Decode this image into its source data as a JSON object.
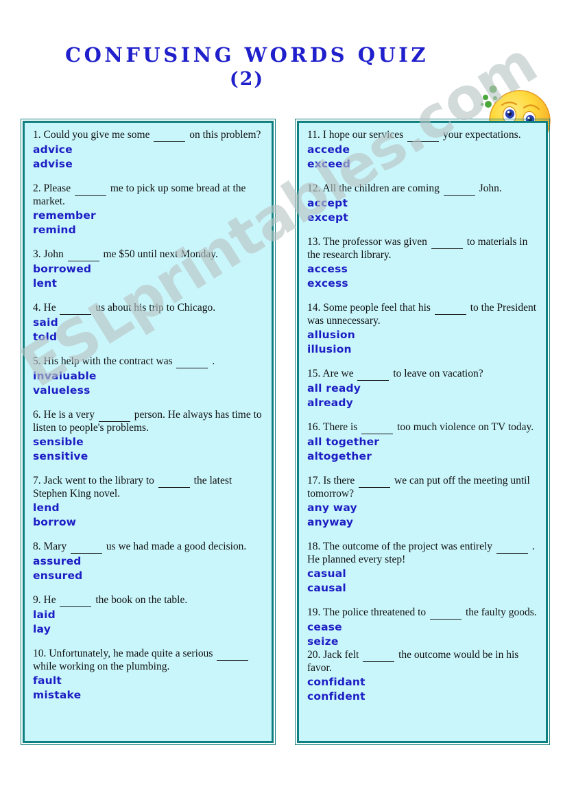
{
  "header": {
    "title_line1": "Confusing Words Quiz",
    "title_line2": "(2)",
    "title_color": "#1f1fcb",
    "emoticon_name": "confused-woozy-face-emoticon"
  },
  "watermark": {
    "text": "ESLprintables.com",
    "color": "#b9c4c4"
  },
  "theme": {
    "box_fill": "#c9f6fb",
    "box_border": "#0f8080",
    "question_color": "#101010",
    "option_color": "#1d1dc4",
    "page_background": "#ffffff"
  },
  "columns": [
    {
      "name": "left-column",
      "items": [
        {
          "number": "1.",
          "text_before": "Could you give me some",
          "text_after": "on this problem?",
          "options": [
            "advice",
            "advise"
          ]
        },
        {
          "number": "2.",
          "text_before": "Please",
          "text_after": "me to pick up some bread at the market.",
          "options": [
            "remember",
            "remind"
          ]
        },
        {
          "number": "3.",
          "text_before": "John",
          "text_after": "me $50 until next Monday.",
          "options": [
            "borrowed",
            "lent"
          ]
        },
        {
          "number": "4.",
          "text_before": "He",
          "text_after": "us about his trip to Chicago.",
          "options": [
            "said",
            "told"
          ]
        },
        {
          "number": "5.",
          "text_before": "His help with the contract was",
          "text_after": ".",
          "options": [
            "invaluable",
            "valueless"
          ]
        },
        {
          "number": "6.",
          "text_before": "He is a very",
          "text_after": "person. He always has time to listen to people's problems.",
          "options": [
            "sensible",
            "sensitive"
          ]
        },
        {
          "number": "7.",
          "text_before": "Jack went to the library to",
          "text_after": "the latest Stephen King novel.",
          "options": [
            "lend",
            "borrow"
          ]
        },
        {
          "number": "8.",
          "text_before": "Mary",
          "text_after": "us we had made a good decision.",
          "options": [
            "assured",
            "ensured"
          ]
        },
        {
          "number": "9.",
          "text_before": "He",
          "text_after": "the book on the table.",
          "options": [
            "laid",
            "lay"
          ]
        },
        {
          "number": "10.",
          "text_before": "Unfortunately, he made quite a serious",
          "text_after": "while working on the plumbing.",
          "options": [
            "fault",
            "mistake"
          ]
        }
      ]
    },
    {
      "name": "right-column",
      "items": [
        {
          "number": "11.",
          "text_before": "I hope our services",
          "text_after": "your expectations.",
          "options": [
            "accede",
            "exceed"
          ]
        },
        {
          "number": "12.",
          "text_before": "All the children are coming",
          "text_after": "John.",
          "options": [
            "accept",
            "except"
          ]
        },
        {
          "number": "13.",
          "text_before": "The professor was given",
          "text_after": "to materials in the research library.",
          "options": [
            "access",
            "excess"
          ]
        },
        {
          "number": "14.",
          "text_before": "Some people feel that his",
          "text_after": "to the President was unnecessary.",
          "options": [
            "allusion",
            "illusion"
          ]
        },
        {
          "number": "15.",
          "text_before": "Are we",
          "text_after": "to leave on vacation?",
          "options": [
            "all ready",
            "already"
          ]
        },
        {
          "number": "16.",
          "text_before": "There is",
          "text_after": "too much violence on TV today.",
          "options": [
            "all together",
            "altogether"
          ]
        },
        {
          "number": "17.",
          "text_before": "Is there",
          "text_after": "we can put off the meeting until tomorrow?",
          "options": [
            "any way",
            "anyway"
          ]
        },
        {
          "number": "18.",
          "text_before": "The outcome of the project was entirely",
          "text_after": ". He planned every step!",
          "options": [
            "casual",
            "causal"
          ]
        },
        {
          "number": "19.",
          "text_before": "The police threatened to",
          "text_after": "the faulty goods.",
          "options": [
            "cease",
            "seize"
          ],
          "tight": true
        },
        {
          "number": "20.",
          "text_before": "Jack felt",
          "text_after": "the outcome would be in his favor.",
          "options": [
            "confidant",
            "confident"
          ]
        }
      ]
    }
  ]
}
